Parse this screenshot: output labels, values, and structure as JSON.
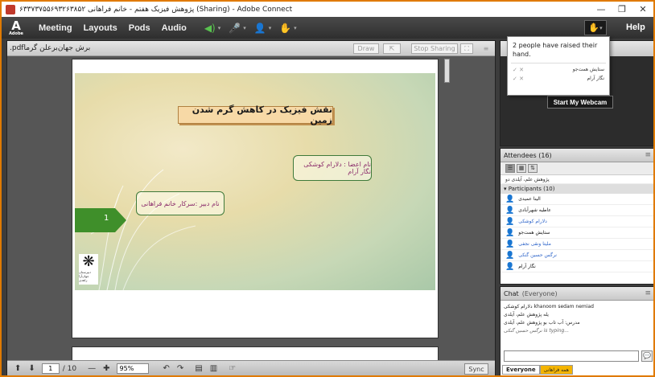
{
  "window": {
    "title": "۶۳۳۷۳۷۵۵۶۹۳۲۶۳۸۵۲ پژوهش فیزیک هفتم - خانم فراهانی (Sharing) - Adobe Connect",
    "min": "—",
    "max": "❐",
    "close": "✕"
  },
  "menubar": {
    "logo_mark": "A",
    "logo_word": "Adobe",
    "items": [
      "Meeting",
      "Layouts",
      "Pods",
      "Audio"
    ],
    "speaker_glyph": "◀)",
    "mic_glyph": "🎤",
    "camera_glyph": "👤",
    "raise_glyph": "✋",
    "caret": "▾",
    "help": "Help"
  },
  "share": {
    "filename": ".pdfبرش جهان‌برعلن گرما",
    "draw": "Draw",
    "stop_sharing": "Stop Sharing",
    "slide_title": "نقش فیزیک در کاهش گرم شدن زمین",
    "members_box": "نام اعضا : دلارام کوشکی نگار آرام",
    "teacher_box": "نام دبیر :سرکار خانم فراهانی",
    "slide_number": "1",
    "logo_caption": "دبیرستان جهان‌آرا زاهدی",
    "logo_mark": "❋",
    "footer": {
      "up": "⬆",
      "down": "⬇",
      "page": "1",
      "total": "/ 10",
      "zoom_out": "—",
      "zoom_in": "✚",
      "zoom": "95%",
      "rot_left": "↶",
      "rot_right": "↷",
      "sync": "Sync"
    }
  },
  "webcam": {
    "button": "Start My Webcam"
  },
  "raise_popup": {
    "message": "2 people have raised their hand.",
    "people": [
      "ستایش همت‌جو",
      "نگار آرام"
    ],
    "actions": "✓ ✕"
  },
  "attendees": {
    "header": "Attendees  (16)",
    "menu": "≡",
    "host_label": "پژوهش علم، آیلدی دو",
    "participants_header": "▾ Participants (10)",
    "participants": [
      {
        "name": "الینا عمیدی",
        "color": "dark"
      },
      {
        "name": "عاطیه شهرآبادی",
        "color": "dark"
      },
      {
        "name": "دلارام کوشکی",
        "color": "blue"
      },
      {
        "name": "ستایش همت‌جو",
        "color": "dark"
      },
      {
        "name": "ملیتا ونقی نجفی",
        "color": "blue"
      },
      {
        "name": "نرگس حسین گنکی",
        "color": "blue"
      },
      {
        "name": "نگار آرام",
        "color": "dark"
      }
    ]
  },
  "chat": {
    "header": "Chat",
    "scope": "(Everyone)",
    "menu": "≡",
    "lines": [
      "دلارام کوشکی khanoom sedam nemiad",
      "یله پژوهش علم، آیلدی",
      "مدرس: آب تاب بو پژوهش علم، آیلدی"
    ],
    "typing": "نرگس حسین گنکی is typing...",
    "send_glyph": "💬",
    "tabs": [
      "Everyone",
      "همه فراهانی"
    ]
  },
  "colors": {
    "accent_border": "#e07a00",
    "slide_green": "#3f8f2a"
  }
}
